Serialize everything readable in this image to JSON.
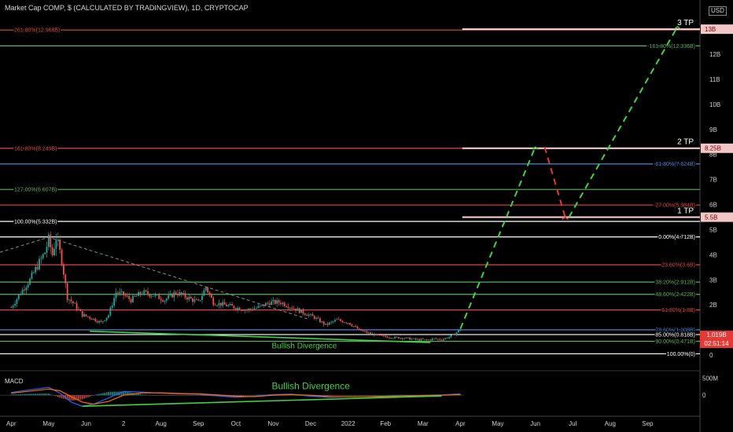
{
  "header": {
    "title": "Market Cap COMP, $ (CALCULATED BY TRADINGVIEW), 1D, CRYPTOCAP",
    "currency": "USD"
  },
  "price_tag": {
    "value": "1.019B",
    "countdown": "02:51:14"
  },
  "macd_label": "MACD",
  "colors": {
    "background": "#000000",
    "red_level": "#e04646",
    "green_level": "#5fb05f",
    "white_level": "#ffffff",
    "blue_level": "#4a86d0",
    "projection_green": "#43d043",
    "projection_red": "#e53935",
    "divergence": "#43d043",
    "macd_line": "#2962ff",
    "signal_line": "#ff6d00"
  },
  "chart_data": [
    {
      "type": "candlestick",
      "title": "Market Cap COMP, $ (CALCULATED BY TRADINGVIEW), 1D, CRYPTOCAP",
      "ylabel": "USD",
      "ylim": [
        -0.5,
        13.6
      ],
      "y_ticks": [
        "12B",
        "11B",
        "10B",
        "9B",
        "8B",
        "7B",
        "6B",
        "5B",
        "4B",
        "3B",
        "2B",
        "0"
      ],
      "y_tick_values": [
        12,
        11,
        10,
        9,
        8,
        7,
        6,
        5,
        4,
        3,
        2,
        0
      ],
      "x_ticks": [
        "Apr",
        "May",
        "Jun",
        "2",
        "Aug",
        "Sep",
        "Oct",
        "Nov",
        "Dec",
        "2022",
        "Feb",
        "Mar",
        "Apr",
        "May",
        "Jun",
        "Jul",
        "Aug",
        "Sep"
      ],
      "x_tick_months": [
        0,
        1,
        2,
        3,
        4,
        5,
        6,
        7,
        8,
        9,
        10,
        11,
        12,
        13,
        14,
        15,
        16,
        17
      ],
      "x_range_months": [
        -0.3,
        18.4
      ],
      "price_path": [
        [
          0,
          1.9
        ],
        [
          0.3,
          2.6
        ],
        [
          0.5,
          3.0
        ],
        [
          0.75,
          3.7
        ],
        [
          0.9,
          4.1
        ],
        [
          1.0,
          4.6
        ],
        [
          1.1,
          4.0
        ],
        [
          1.2,
          4.7
        ],
        [
          1.35,
          3.8
        ],
        [
          1.5,
          2.3
        ],
        [
          1.7,
          2.0
        ],
        [
          1.9,
          1.6
        ],
        [
          2.1,
          1.5
        ],
        [
          2.4,
          1.3
        ],
        [
          2.6,
          1.6
        ],
        [
          2.8,
          2.5
        ],
        [
          3.0,
          2.4
        ],
        [
          3.2,
          2.2
        ],
        [
          3.5,
          2.5
        ],
        [
          3.8,
          2.4
        ],
        [
          4.1,
          2.2
        ],
        [
          4.4,
          2.5
        ],
        [
          4.7,
          2.3
        ],
        [
          5.0,
          2.1
        ],
        [
          5.2,
          2.7
        ],
        [
          5.4,
          2.1
        ],
        [
          5.7,
          2.0
        ],
        [
          6.0,
          1.9
        ],
        [
          6.3,
          1.8
        ],
        [
          6.6,
          1.9
        ],
        [
          6.9,
          2.1
        ],
        [
          7.2,
          2.1
        ],
        [
          7.5,
          1.9
        ],
        [
          7.8,
          1.7
        ],
        [
          8.1,
          1.5
        ],
        [
          8.4,
          1.2
        ],
        [
          8.7,
          1.4
        ],
        [
          9.0,
          1.3
        ],
        [
          9.3,
          1.0
        ],
        [
          9.6,
          0.85
        ],
        [
          9.9,
          0.75
        ],
        [
          10.2,
          0.7
        ],
        [
          10.5,
          0.68
        ],
        [
          10.8,
          0.62
        ],
        [
          11.1,
          0.6
        ],
        [
          11.3,
          0.65
        ],
        [
          11.5,
          0.62
        ],
        [
          11.7,
          0.72
        ],
        [
          11.85,
          0.85
        ],
        [
          12.0,
          1.019
        ]
      ],
      "dashed_trendline": [
        [
          -0.3,
          4.1
        ],
        [
          1.0,
          4.7
        ],
        [
          7.9,
          1.45
        ]
      ],
      "levels": [
        {
          "label": "261.80%(12.968B)",
          "value": 12.968,
          "color": "red",
          "side": "left"
        },
        {
          "label": "-161.80%(12.336B)",
          "value": 12.336,
          "color": "green",
          "side": "right"
        },
        {
          "label": "161.80%(8.249B)",
          "value": 8.249,
          "color": "red",
          "side": "left"
        },
        {
          "label": "-61.80%(7.624B)",
          "value": 7.624,
          "color": "blue",
          "side": "right"
        },
        {
          "label": "127.00%(6.607B)",
          "value": 6.607,
          "color": "green",
          "side": "left"
        },
        {
          "label": "-27.00%(5.984B)",
          "value": 5.984,
          "color": "red",
          "side": "right"
        },
        {
          "label": "100.00%(5.332B)",
          "value": 5.332,
          "color": "white",
          "side": "left"
        },
        {
          "label": "0.00%(4.712B)",
          "value": 4.712,
          "color": "white",
          "side": "right"
        },
        {
          "label": "23.60%(3.6B)",
          "value": 3.6,
          "color": "red",
          "side": "right"
        },
        {
          "label": "38.20%(2.912B)",
          "value": 2.912,
          "color": "green",
          "side": "right"
        },
        {
          "label": "48.60%(2.422B)",
          "value": 2.422,
          "color": "green",
          "side": "right"
        },
        {
          "label": "61.80%(1.8B)",
          "value": 1.8,
          "color": "red",
          "side": "right"
        },
        {
          "label": "78.60%(1.008B)",
          "value": 1.008,
          "color": "blue",
          "side": "right"
        },
        {
          "label": "85.00%(0.818B)",
          "value": 0.818,
          "color": "white",
          "side": "right"
        },
        {
          "label": "90.00%(0.471B)",
          "value": 0.55,
          "color": "green",
          "side": "right"
        },
        {
          "label": "100.00%(0)",
          "value": 0.05,
          "color": "white",
          "side": "right"
        }
      ],
      "targets": [
        {
          "label": "3 TP",
          "tag": "13B",
          "value": 13.0
        },
        {
          "label": "2 TP",
          "tag": "8.25B",
          "value": 8.25
        },
        {
          "label": "1 TP",
          "tag": "5.5B",
          "value": 5.5
        }
      ],
      "projection_up1": [
        [
          12.0,
          1.05
        ],
        [
          14.0,
          8.3
        ]
      ],
      "projection_down": [
        [
          14.25,
          8.3
        ],
        [
          14.8,
          5.5
        ]
      ],
      "projection_up2": [
        [
          14.9,
          5.5
        ],
        [
          17.8,
          13.1
        ]
      ],
      "divergence_line": [
        [
          2.1,
          0.95
        ],
        [
          11.2,
          0.5
        ]
      ],
      "annotations": [
        {
          "text": "Bullish Divergence",
          "x": 7.8,
          "y": 0.45
        }
      ]
    },
    {
      "type": "line",
      "title": "MACD",
      "y_ticks": [
        "500M",
        "0"
      ],
      "y_tick_values": [
        500,
        0
      ],
      "ylim": [
        -520,
        620
      ],
      "macd_path": [
        [
          0,
          80
        ],
        [
          0.5,
          160
        ],
        [
          1.0,
          230
        ],
        [
          1.3,
          60
        ],
        [
          1.6,
          -200
        ],
        [
          1.9,
          -320
        ],
        [
          2.2,
          -260
        ],
        [
          2.6,
          -80
        ],
        [
          3.0,
          110
        ],
        [
          3.5,
          90
        ],
        [
          4.0,
          60
        ],
        [
          4.5,
          40
        ],
        [
          5.0,
          30
        ],
        [
          5.5,
          -20
        ],
        [
          6.0,
          -60
        ],
        [
          6.5,
          -30
        ],
        [
          7.0,
          20
        ],
        [
          7.5,
          30
        ],
        [
          8.0,
          -30
        ],
        [
          8.5,
          -60
        ],
        [
          9.0,
          -40
        ],
        [
          9.5,
          -40
        ],
        [
          10.0,
          -30
        ],
        [
          10.5,
          -10
        ],
        [
          11.0,
          -5
        ],
        [
          11.5,
          10
        ],
        [
          12.0,
          40
        ]
      ],
      "signal_path": [
        [
          0,
          60
        ],
        [
          0.5,
          120
        ],
        [
          1.0,
          180
        ],
        [
          1.3,
          130
        ],
        [
          1.6,
          -40
        ],
        [
          1.9,
          -200
        ],
        [
          2.2,
          -260
        ],
        [
          2.6,
          -180
        ],
        [
          3.0,
          0
        ],
        [
          3.5,
          70
        ],
        [
          4.0,
          70
        ],
        [
          4.5,
          50
        ],
        [
          5.0,
          40
        ],
        [
          5.5,
          10
        ],
        [
          6.0,
          -30
        ],
        [
          6.5,
          -40
        ],
        [
          7.0,
          0
        ],
        [
          7.5,
          20
        ],
        [
          8.0,
          0
        ],
        [
          8.5,
          -40
        ],
        [
          9.0,
          -45
        ],
        [
          9.5,
          -40
        ],
        [
          10.0,
          -35
        ],
        [
          10.5,
          -20
        ],
        [
          11.0,
          -10
        ],
        [
          11.5,
          0
        ],
        [
          12.0,
          20
        ]
      ],
      "divergence_line": [
        [
          1.9,
          -320
        ],
        [
          11.5,
          -20
        ]
      ],
      "annotations": [
        {
          "text": "Bullish Divergence",
          "x": 7.8,
          "y": 180
        }
      ]
    }
  ]
}
